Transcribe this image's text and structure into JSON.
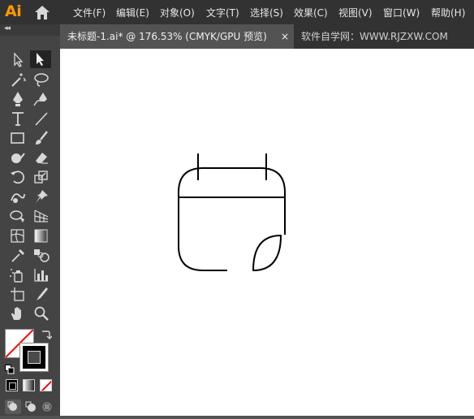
{
  "app": {
    "logo": "Ai"
  },
  "menu": [
    "文件(F)",
    "编辑(E)",
    "对象(O)",
    "文字(T)",
    "选择(S)",
    "效果(C)",
    "视图(V)",
    "窗口(W)",
    "帮助(H)"
  ],
  "tabs": {
    "active": "未标题-1.ai* @ 176.53% (CMYK/GPU 预览)",
    "close": "×",
    "other": "软件自学网：WWW.RJZXW.COM"
  },
  "toolbar": {
    "collapse": "◂◂"
  },
  "colors": {
    "accent": "#ff9a00",
    "menubar": "#323232",
    "toolbar": "#444444",
    "workspace": "#535353",
    "fill_none": "#ff0000",
    "stroke": "#000000"
  }
}
